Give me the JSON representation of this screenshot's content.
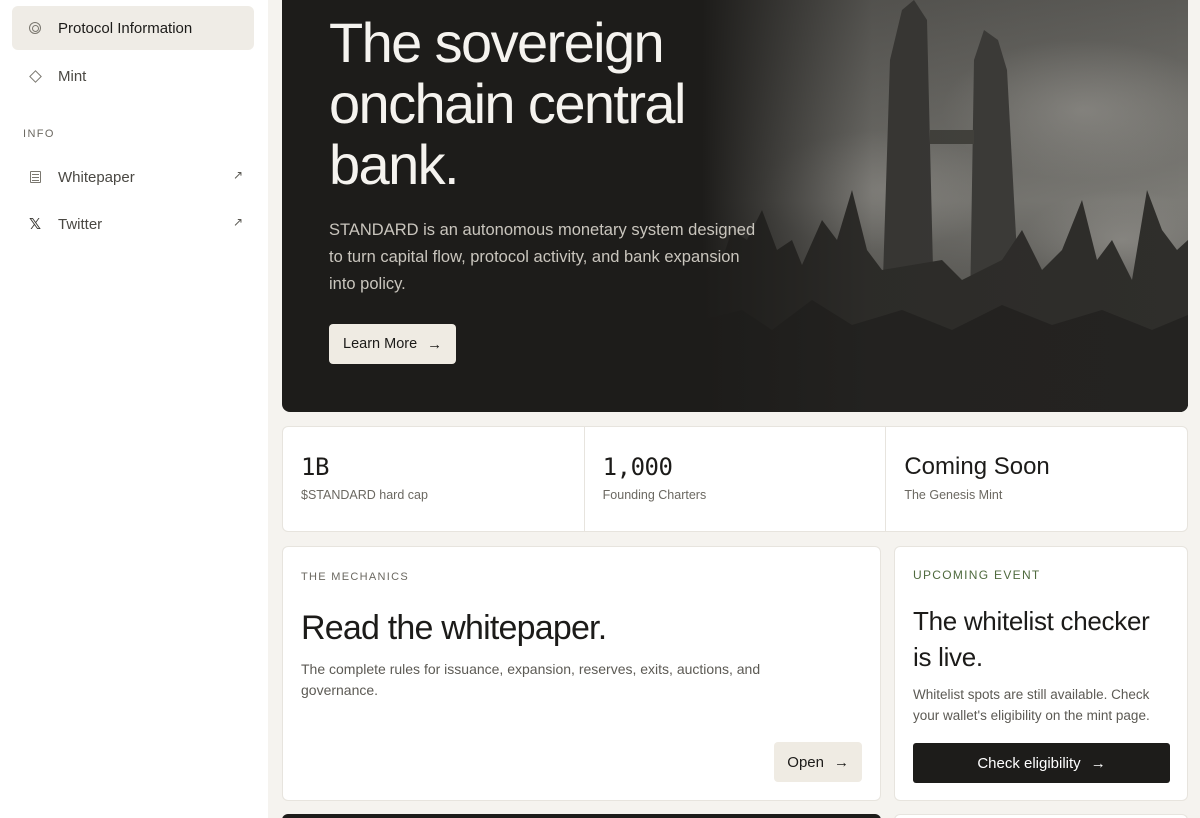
{
  "sidebar": {
    "items": [
      {
        "label": "Protocol Information",
        "icon": "protocol-ring-icon"
      },
      {
        "label": "Mint",
        "icon": "diamond-icon"
      }
    ],
    "section_label": "INFO",
    "links": [
      {
        "label": "Whitepaper",
        "icon": "document-icon",
        "external": "↗"
      },
      {
        "label": "Twitter",
        "icon": "x-logo-icon",
        "external": "↗"
      }
    ]
  },
  "hero": {
    "title": "The sovereign onchain central bank.",
    "description": "STANDARD is an autonomous monetary system designed to turn capital flow, protocol activity, and bank expansion into policy.",
    "button_label": "Learn More",
    "button_icon": "→"
  },
  "stats": [
    {
      "value": "1B",
      "label": "$STANDARD hard cap"
    },
    {
      "value": "1,000",
      "label": "Founding Charters"
    },
    {
      "value": "Coming Soon",
      "label": "The Genesis Mint"
    }
  ],
  "mechanics": {
    "eyebrow": "THE MECHANICS",
    "title": "Read the whitepaper.",
    "description": "The complete rules for issuance, expansion, reserves, exits, auctions, and governance.",
    "button_label": "Open",
    "button_icon": "→"
  },
  "event": {
    "eyebrow": "UPCOMING EVENT",
    "title": "The whitelist checker is live.",
    "description": "Whitelist spots are still available. Check your wallet's eligibility on the mint page.",
    "button_label": "Check eligibility",
    "button_icon": "→"
  },
  "colors": {
    "background": "#f5f3ef",
    "hero_bg": "#1d1c1a",
    "accent_green": "#4f6a3e",
    "button_light": "#efebe3"
  }
}
